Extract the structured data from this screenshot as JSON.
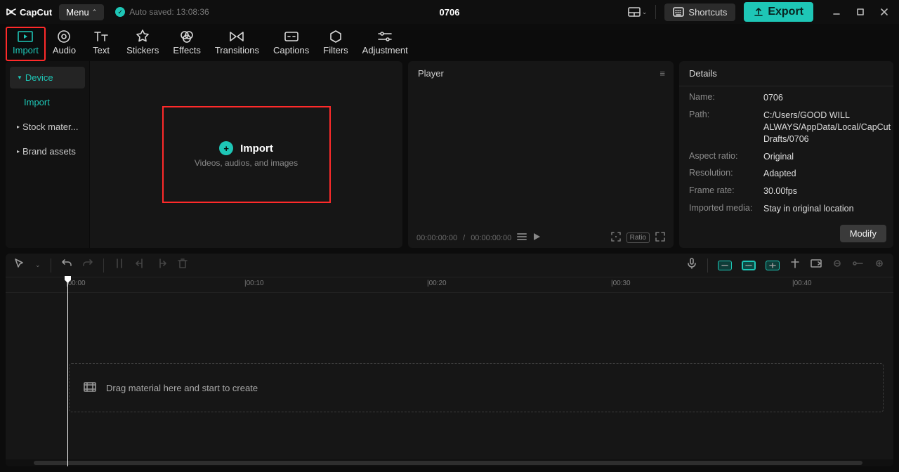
{
  "app_name": "CapCut",
  "menu_label": "Menu",
  "auto_saved_label": "Auto saved: 13:08:36",
  "project_title": "0706",
  "shortcuts_label": "Shortcuts",
  "export_label": "Export",
  "tabs": {
    "import": "Import",
    "audio": "Audio",
    "text": "Text",
    "stickers": "Stickers",
    "effects": "Effects",
    "transitions": "Transitions",
    "captions": "Captions",
    "filters": "Filters",
    "adjustment": "Adjustment"
  },
  "sidebar": {
    "device": "Device",
    "import": "Import",
    "stock": "Stock mater...",
    "brand": "Brand assets"
  },
  "import_box": {
    "title": "Import",
    "subtitle": "Videos, audios, and images"
  },
  "player": {
    "title": "Player",
    "time_current": "00:00:00:00",
    "time_total": "00:00:00:00",
    "ratio_chip": "Ratio"
  },
  "details": {
    "title": "Details",
    "name_label": "Name:",
    "name_value": "0706",
    "path_label": "Path:",
    "path_value": "C:/Users/GOOD WILL ALWAYS/AppData/Local/CapCut Drafts/0706",
    "aspect_label": "Aspect ratio:",
    "aspect_value": "Original",
    "res_label": "Resolution:",
    "res_value": "Adapted",
    "fps_label": "Frame rate:",
    "fps_value": "30.00fps",
    "media_label": "Imported media:",
    "media_value": "Stay in original location",
    "modify_label": "Modify"
  },
  "ruler": {
    "t0": "|00:00",
    "t1": "|00:10",
    "t2": "|00:20",
    "t3": "|00:30",
    "t4": "|00:40"
  },
  "drop_hint": "Drag material here and start to create"
}
